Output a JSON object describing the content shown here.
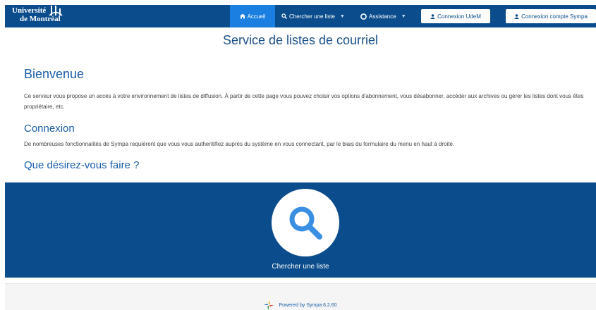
{
  "brand": {
    "line1": "Université",
    "line2": "de Montréal"
  },
  "nav": {
    "accueil": "Accueil",
    "chercher": "Chercher une liste",
    "assistance": "Assistance",
    "caret": "▼"
  },
  "login": {
    "udem": "Connexion UdeM",
    "sympa": "Connexion compte Sympa"
  },
  "site_title": "Service de listes de courriel",
  "welcome": {
    "heading": "Bienvenue",
    "text": "Ce serveur vous propose un accès à votre environnement de listes de diffusion. À partir de cette page vous pouvez choisir vos options d'abonnement, vous désabonner, accéder aux archives ou gérer les listes dont vous êtes propriétaire, etc."
  },
  "connexion": {
    "heading": "Connexion",
    "text": "De nombreuses fonctionnalités de Sympa requièrent que vous vous authentifiez auprès du système en vous connectant, par le biais du formulaire du menu en haut à droite."
  },
  "que_faire": {
    "heading": "Que désirez-vous faire ?"
  },
  "panel": {
    "label": "Chercher une liste"
  },
  "footer": {
    "powered": "Powered by Sympa 6.2.60"
  },
  "colors": {
    "navbar": "#0b4d8c",
    "active": "#1a7fe0",
    "heading": "#1a5fa8",
    "panel": "#0b4d8c",
    "search_icon": "#3b8fe2"
  },
  "icons": {
    "home": "home-icon",
    "search": "search-icon",
    "assistance": "lifebuoy-icon",
    "user": "user-icon",
    "logo": "sympa-logo-icon"
  }
}
